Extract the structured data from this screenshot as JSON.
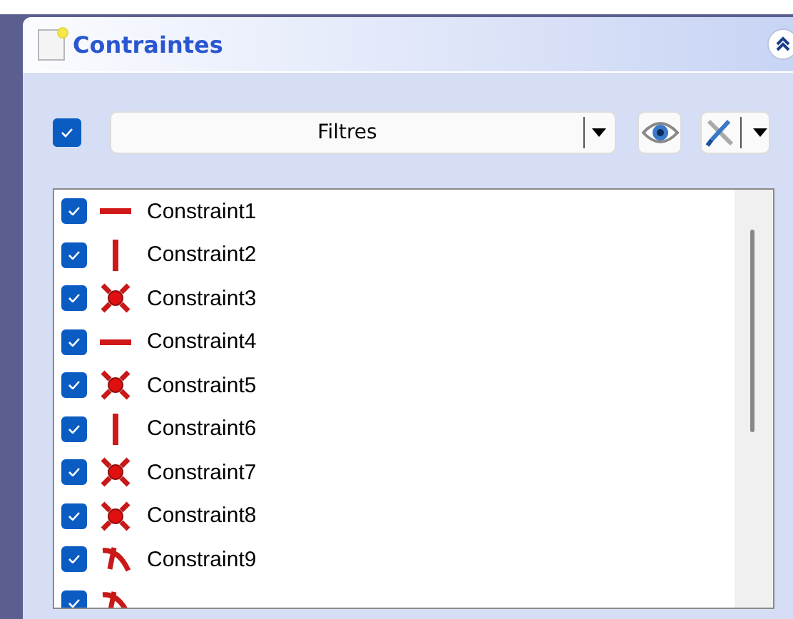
{
  "panel": {
    "title": "Contraintes"
  },
  "toolbar": {
    "show_all_checked": true,
    "filter_label": "Filtres"
  },
  "constraints": [
    {
      "label": "Constraint1",
      "kind": "horizontal",
      "checked": true
    },
    {
      "label": "Constraint2",
      "kind": "vertical",
      "checked": true
    },
    {
      "label": "Constraint3",
      "kind": "coincident",
      "checked": true
    },
    {
      "label": "Constraint4",
      "kind": "horizontal",
      "checked": true
    },
    {
      "label": "Constraint5",
      "kind": "coincident",
      "checked": true
    },
    {
      "label": "Constraint6",
      "kind": "vertical",
      "checked": true
    },
    {
      "label": "Constraint7",
      "kind": "coincident",
      "checked": true
    },
    {
      "label": "Constraint8",
      "kind": "coincident",
      "checked": true
    },
    {
      "label": "Constraint9",
      "kind": "tangent",
      "checked": true
    },
    {
      "kind": "tangent",
      "checked": true
    }
  ]
}
